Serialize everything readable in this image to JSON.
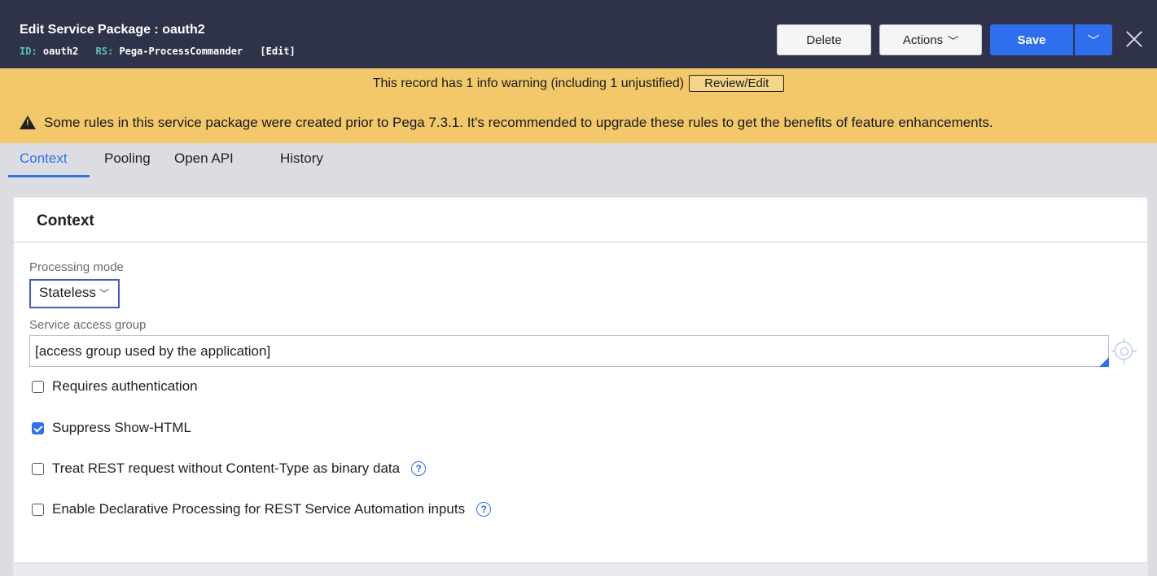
{
  "header": {
    "title": "Edit  Service Package : oauth2",
    "id_key": "ID:",
    "id_value": "oauth2",
    "rs_key": "RS:",
    "rs_value": "Pega-ProcessCommander",
    "edit_link": "[Edit]",
    "delete_label": "Delete",
    "actions_label": "Actions",
    "save_label": "Save"
  },
  "warnings": {
    "summary": "This record has 1 info warning (including 1 unjustified)",
    "review_label": "Review/Edit",
    "upgrade_message": "Some rules in this service package were created prior to Pega 7.3.1. It's recommended to upgrade these rules to get the benefits of feature enhancements."
  },
  "tabs": [
    {
      "label": "Context",
      "active": true
    },
    {
      "label": "Pooling",
      "active": false
    },
    {
      "label": "Open API",
      "active": false
    },
    {
      "label": "History",
      "active": false
    }
  ],
  "context": {
    "title": "Context",
    "processing_mode_label": "Processing mode",
    "processing_mode_value": "Stateless",
    "access_group_label": "Service access group",
    "access_group_value": "[access group used by the application]",
    "options": [
      {
        "label": "Requires authentication",
        "checked": false
      },
      {
        "label": "Suppress Show-HTML",
        "checked": true
      },
      {
        "label": "Treat REST request without Content-Type as binary data",
        "checked": false
      },
      {
        "label": "Enable Declarative Processing for REST Service Automation inputs",
        "checked": false
      }
    ]
  },
  "colors": {
    "header_bg": "#2f3349",
    "accent": "#2f6fed",
    "warning_bg": "#f2c86b"
  }
}
